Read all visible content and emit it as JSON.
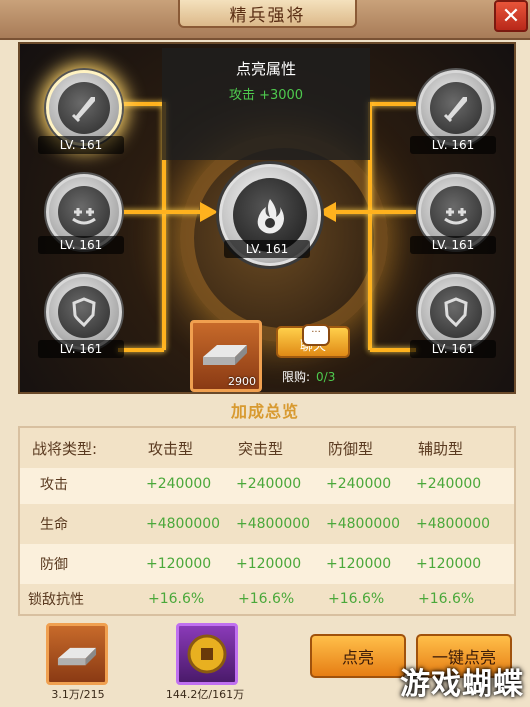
{
  "header": {
    "title": "精兵强将",
    "close_label": "✕"
  },
  "attributes": {
    "title": "点亮属性",
    "value": "攻击 +3000"
  },
  "nodes": {
    "left_top": "LV. 161",
    "left_mid": "LV. 161",
    "left_bot": "LV. 161",
    "right_top": "LV. 161",
    "right_mid": "LV. 161",
    "right_bot": "LV. 161",
    "center": "LV. 161"
  },
  "item": {
    "count": "2900"
  },
  "chat": {
    "label": "聊天",
    "bubble": "···"
  },
  "limit": {
    "label": "限购:",
    "value": "0/3"
  },
  "summary_title": "加成总览",
  "table": {
    "header": [
      "战将类型:",
      "攻击型",
      "突击型",
      "防御型",
      "辅助型"
    ],
    "rows": [
      {
        "label": "攻击",
        "values": [
          "+240000",
          "+240000",
          "+240000",
          "+240000"
        ]
      },
      {
        "label": "生命",
        "values": [
          "+4800000",
          "+4800000",
          "+4800000",
          "+4800000"
        ]
      },
      {
        "label": "防御",
        "values": [
          "+120000",
          "+120000",
          "+120000",
          "+120000"
        ]
      },
      {
        "label": "锁敌抗性",
        "values": [
          "+16.6%",
          "+16.6%",
          "+16.6%",
          "+16.6%"
        ]
      }
    ]
  },
  "resources": {
    "silver": "3.1万/215",
    "coin": "144.2亿/161万"
  },
  "buttons": {
    "light": "点亮",
    "one_click": "一键点亮"
  },
  "watermark": "游戏蝴蝶",
  "colors": {
    "accent": "#ffb21e",
    "positive": "#4aa83a",
    "title": "#d89a30"
  }
}
